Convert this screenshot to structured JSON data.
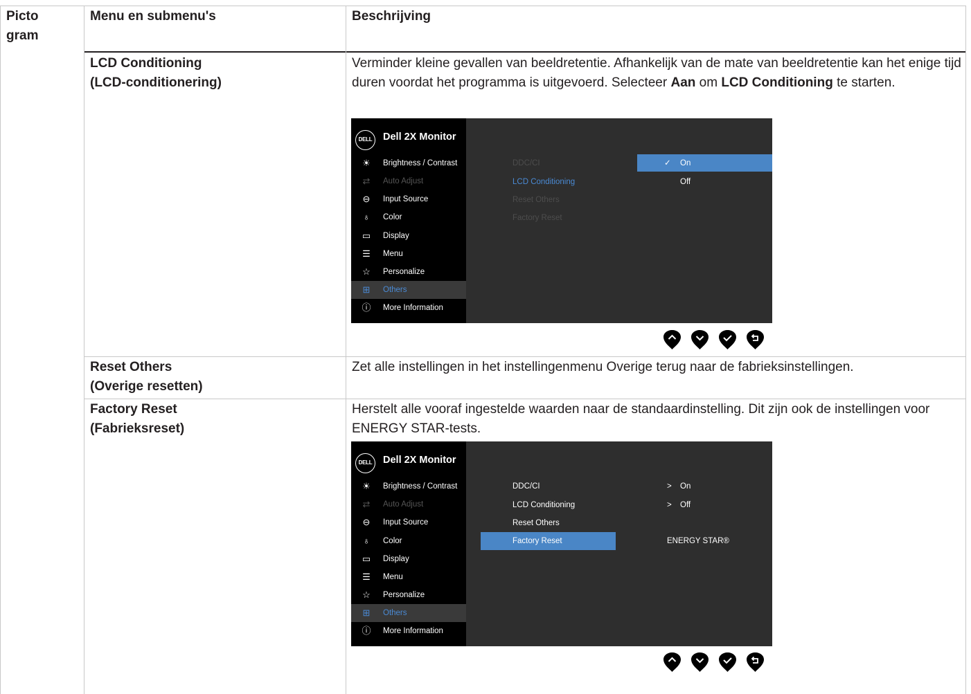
{
  "table": {
    "headers": {
      "col1": "Picto gram",
      "col1_line1": "Picto",
      "col1_line2": "gram",
      "col2": "Menu en submenu's",
      "col3": "Beschrijving"
    },
    "rows": [
      {
        "menu_line1": "LCD Conditioning",
        "menu_line2": "(LCD-conditionering)",
        "desc_part1": "Verminder kleine gevallen van beeldretentie. Afhankelijk van de mate van beeldretentie kan het enige tijd duren voordat het programma is uitgevoerd. Selecteer ",
        "desc_bold1": "Aan",
        "desc_part2": " om ",
        "desc_bold2": "LCD Conditioning",
        "desc_part3": " te starten."
      },
      {
        "menu_line1": "Reset Others",
        "menu_line2": "(Overige resetten)",
        "desc": "Zet alle instellingen in het instellingenmenu Overige terug naar de fabrieksinstellingen."
      },
      {
        "menu_line1": "Factory Reset",
        "menu_line2": "(Fabrieksreset)",
        "desc": "Herstelt alle vooraf ingestelde waarden naar de standaardinstelling. Dit zijn ook de instellingen voor ENERGY STAR-tests."
      }
    ]
  },
  "osd": {
    "logo": "DELL",
    "title": "Dell 2X Monitor",
    "menu_items": [
      {
        "label": "Brightness / Contrast",
        "icon": "brightness-icon",
        "glyph": "☀"
      },
      {
        "label": "Auto Adjust",
        "icon": "auto-adjust-icon",
        "glyph": "⇄"
      },
      {
        "label": "Input Source",
        "icon": "input-source-icon",
        "glyph": "⊖"
      },
      {
        "label": "Color",
        "icon": "color-icon",
        "glyph": "♁"
      },
      {
        "label": "Display",
        "icon": "display-icon",
        "glyph": "▭"
      },
      {
        "label": "Menu",
        "icon": "menu-icon",
        "glyph": "☰"
      },
      {
        "label": "Personalize",
        "icon": "star-icon",
        "glyph": "☆"
      },
      {
        "label": "Others",
        "icon": "others-icon",
        "glyph": "⊞"
      },
      {
        "label": "More Information",
        "icon": "info-icon",
        "glyph": "ⓘ"
      }
    ],
    "screen1": {
      "submenu": [
        "DDC/CI",
        "LCD Conditioning",
        "Reset Others",
        "Factory Reset"
      ],
      "options": [
        {
          "label": "On",
          "check": "✓"
        },
        {
          "label": "Off"
        }
      ]
    },
    "screen2": {
      "submenu": [
        "DDC/CI",
        "LCD Conditioning",
        "Reset Others",
        "Factory Reset"
      ],
      "values": [
        {
          "arrow": ">",
          "label": "On"
        },
        {
          "arrow": ">",
          "label": "Off"
        }
      ],
      "energy_star": "ENERGY STAR®"
    },
    "buttons": [
      "up-button",
      "down-button",
      "ok-button",
      "back-button"
    ]
  },
  "colors": {
    "osd_bg": "#2e2e2e",
    "sidebar_bg": "#000000",
    "highlight": "#4a86c6",
    "selected_text": "#4a8ad4"
  }
}
